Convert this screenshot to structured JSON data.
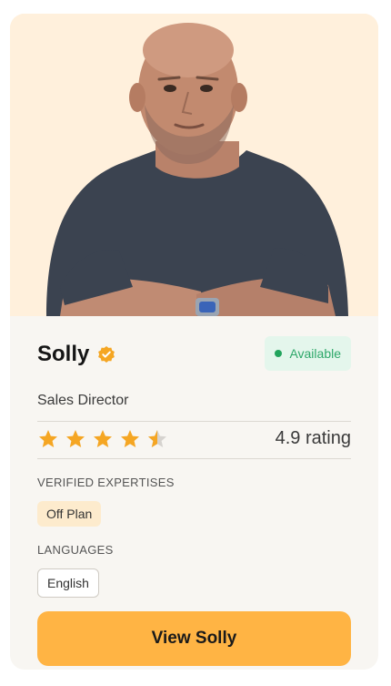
{
  "agent": {
    "name": "Solly",
    "verified_icon": "verified-check-icon",
    "role": "Sales Director",
    "photo": "agent-portrait",
    "status": "Available"
  },
  "rating": {
    "value": 4.5,
    "max": 5,
    "text": "4.9 rating"
  },
  "expertises": {
    "label": "VERIFIED EXPERTISES",
    "items": [
      "Off Plan"
    ]
  },
  "languages": {
    "label": "LANGUAGES",
    "items": [
      "English"
    ]
  },
  "cta": {
    "label": "View Solly"
  },
  "colors": {
    "accent": "#ffb444",
    "photo_bg": "#fff0dc",
    "card_bg": "#f8f6f2",
    "available": "#22a45d",
    "star": "#f5a623"
  }
}
